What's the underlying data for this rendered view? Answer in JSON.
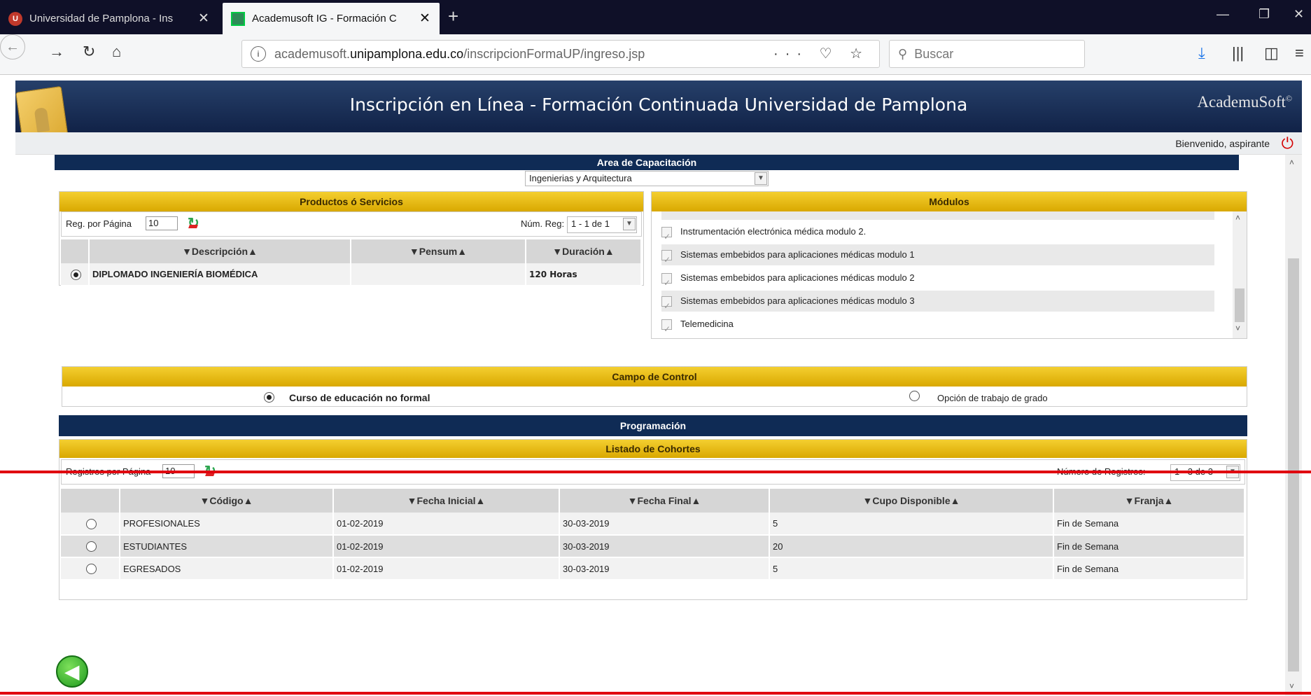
{
  "browser": {
    "tabs": [
      {
        "title": "Universidad de Pamplona - Ins",
        "favicon": "u-icon",
        "active": false
      },
      {
        "title": "Academusoft IG - Formación C",
        "favicon": "image-icon",
        "active": true
      }
    ],
    "url_prefix": "academusoft.",
    "url_domain": "unipamplona.edu.co",
    "url_path": "/inscripcionFormaUP/ingreso.jsp",
    "search_placeholder": "Buscar"
  },
  "header": {
    "title": "Inscripción en Línea - Formación Continuada Universidad de Pamplona",
    "brand": "AcademuSoft",
    "brand_mark": "©",
    "welcome": "Bienvenido, aspirante"
  },
  "area": {
    "label": "Area de Capacitación",
    "selected": "Ingenierias y Arquitectura"
  },
  "productos": {
    "title": "Productos ó Servicios",
    "reg_por_pagina_label": "Reg. por Página",
    "reg_por_pagina": "10",
    "num_reg_label": "Núm. Reg:",
    "num_reg": "1 - 1 de 1",
    "columns": [
      "▼Descripción▲",
      "▼Pensum▲",
      "▼Duración▲"
    ],
    "rows": [
      {
        "descripcion": "DIPLOMADO INGENIERÍA BIOMÉDICA",
        "pensum": "",
        "duracion": "120 Horas",
        "selected": true
      }
    ]
  },
  "modulos": {
    "title": "Módulos",
    "items": [
      "Instrumentación electrónica médica modulo 2.",
      "Sistemas embebidos para aplicaciones médicas modulo 1",
      "Sistemas embebidos para aplicaciones médicas modulo 2",
      "Sistemas embebidos para aplicaciones médicas modulo 3",
      "Telemedicina"
    ]
  },
  "campo": {
    "title": "Campo de Control",
    "option1": "Curso de educación no formal",
    "option2": "Opción de trabajo de grado"
  },
  "programacion": {
    "title": "Programación"
  },
  "cohortes": {
    "title": "Listado de Cohortes",
    "registros_label": "Registros por Página",
    "registros": "10",
    "numero_label": "Número de Registros:",
    "numero": "1 - 3 de 3",
    "columns": [
      "▼Código▲",
      "▼Fecha Inicial▲",
      "▼Fecha Final▲",
      "▼Cupo Disponible▲",
      "▼Franja▲"
    ],
    "rows": [
      {
        "codigo": "PROFESIONALES",
        "inicio": "01-02-2019",
        "fin": "30-03-2019",
        "cupo": "5",
        "franja": "Fin de Semana"
      },
      {
        "codigo": "ESTUDIANTES",
        "inicio": "01-02-2019",
        "fin": "30-03-2019",
        "cupo": "20",
        "franja": "Fin de Semana"
      },
      {
        "codigo": "EGRESADOS",
        "inicio": "01-02-2019",
        "fin": "30-03-2019",
        "cupo": "5",
        "franja": "Fin de Semana"
      }
    ]
  },
  "colors": {
    "navy": "#0f2b55",
    "gold": "#e8bd10",
    "highlight_line": "#e0000f"
  }
}
